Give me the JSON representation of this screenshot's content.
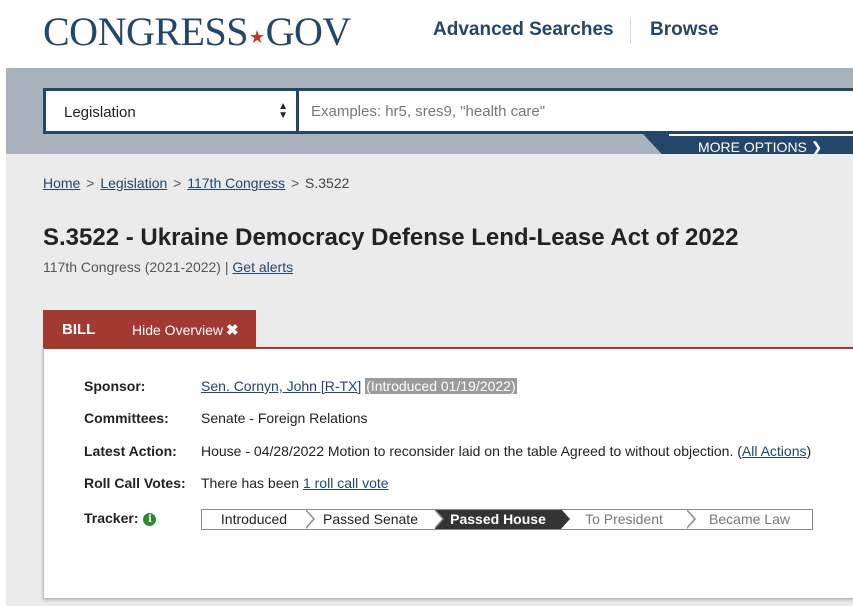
{
  "header": {
    "logo_main": "CONGRESS",
    "logo_star": "★",
    "logo_tld": "GOV",
    "nav": [
      "Advanced Searches",
      "Browse"
    ]
  },
  "search": {
    "scope_value": "Legislation",
    "placeholder": "Examples: hr5, sres9, \"health care\"",
    "more_options": "MORE OPTIONS ❯"
  },
  "breadcrumb": {
    "items": [
      "Home",
      "Legislation",
      "117th Congress"
    ],
    "separator": ">",
    "current": "S.3522"
  },
  "bill": {
    "title": "S.3522 - Ukraine Democracy Defense Lend-Lease Act of 2022",
    "congress": "117th Congress (2021-2022) | ",
    "alerts_link": "Get alerts"
  },
  "tab": {
    "label": "BILL",
    "toggle": "Hide Overview",
    "toggle_icon": "✖"
  },
  "overview": {
    "sponsor_label": "Sponsor:",
    "sponsor_name": "Sen. Cornyn, John [R-TX]",
    "sponsor_intro": "(Introduced 01/19/2022)",
    "committees_label": "Committees:",
    "committees_value": "Senate - Foreign Relations",
    "latest_label": "Latest Action:",
    "latest_value": "House - 04/28/2022 Motion to reconsider laid on the table Agreed to without objection.  (",
    "latest_link": "All Actions",
    "latest_close": ")",
    "rollcall_label": "Roll Call Votes:",
    "rollcall_prefix": "There has been ",
    "rollcall_link": "1 roll call vote",
    "tracker_label": "Tracker:",
    "tracker_icon": "i"
  },
  "tracker": {
    "steps": [
      "Introduced",
      "Passed Senate",
      "Passed House",
      "To President",
      "Became Law"
    ],
    "current_step": "Passed House"
  },
  "colors": {
    "brand_navy": "#23466b",
    "bill_tab_red": "#a33a31",
    "tracker_current": "#343434",
    "info_green": "#2e8a2e"
  }
}
